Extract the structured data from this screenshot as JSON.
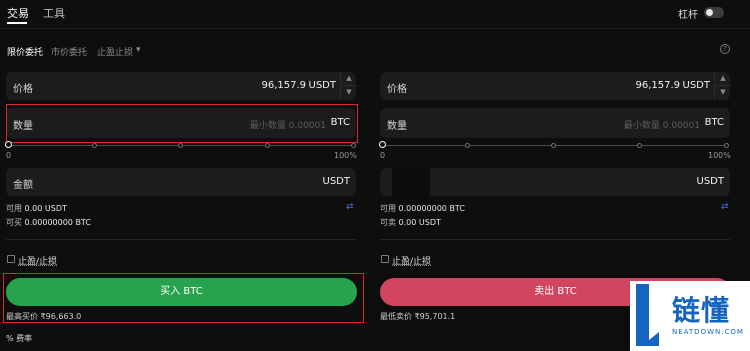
{
  "top_tabs": {
    "trade": "交易",
    "tools": "工具"
  },
  "leverage": {
    "label": "杠杆",
    "enabled": false
  },
  "order_types": {
    "limit": "限价委托",
    "market": "市价委托",
    "tpsl": "止盈止损",
    "tpsl_chevron": "▾"
  },
  "help_icon": "?",
  "buy": {
    "price_label": "价格",
    "price_value": "96,157.9",
    "price_unit": "USDT",
    "qty_label": "数量",
    "qty_placeholder": "最小数量 0.00001",
    "qty_unit": "BTC",
    "slider_min": "0",
    "slider_max": "100%",
    "amount_label": "金额",
    "amount_unit": "USDT",
    "available_label": "可用",
    "available_value": "0.00 USDT",
    "can_buy_label": "可买",
    "can_buy_value": "0.00000000 BTC",
    "tpsl_label": "止盈/止损",
    "button": "买入 BTC",
    "best_price": "最高买价 ₹96,663.0"
  },
  "sell": {
    "price_label": "价格",
    "price_value": "96,157.9",
    "price_unit": "USDT",
    "qty_label": "数量",
    "qty_placeholder": "最小数量 0.00001",
    "qty_unit": "BTC",
    "slider_min": "0",
    "slider_max": "100%",
    "amount_unit": "USDT",
    "available_label": "可用",
    "available_value": "0.00000000 BTC",
    "can_sell_label": "可卖",
    "can_sell_value": "0.00 USDT",
    "tpsl_label": "止盈/止损",
    "button": "卖出 BTC",
    "best_price": "最低卖价 ₹95,701.1"
  },
  "fee": {
    "icon": "%",
    "label": "费率"
  },
  "icons": {
    "swap": "⇄",
    "stepper_up": "▲",
    "stepper_down": "▼"
  },
  "watermark": {
    "cn": "链懂",
    "en": "NEATDOWN.COM"
  },
  "colors": {
    "buy": "#27a24d",
    "sell": "#d2455f",
    "highlight": "#d62a2a",
    "accent": "#3a74d8",
    "watermark": "#1565c0"
  }
}
